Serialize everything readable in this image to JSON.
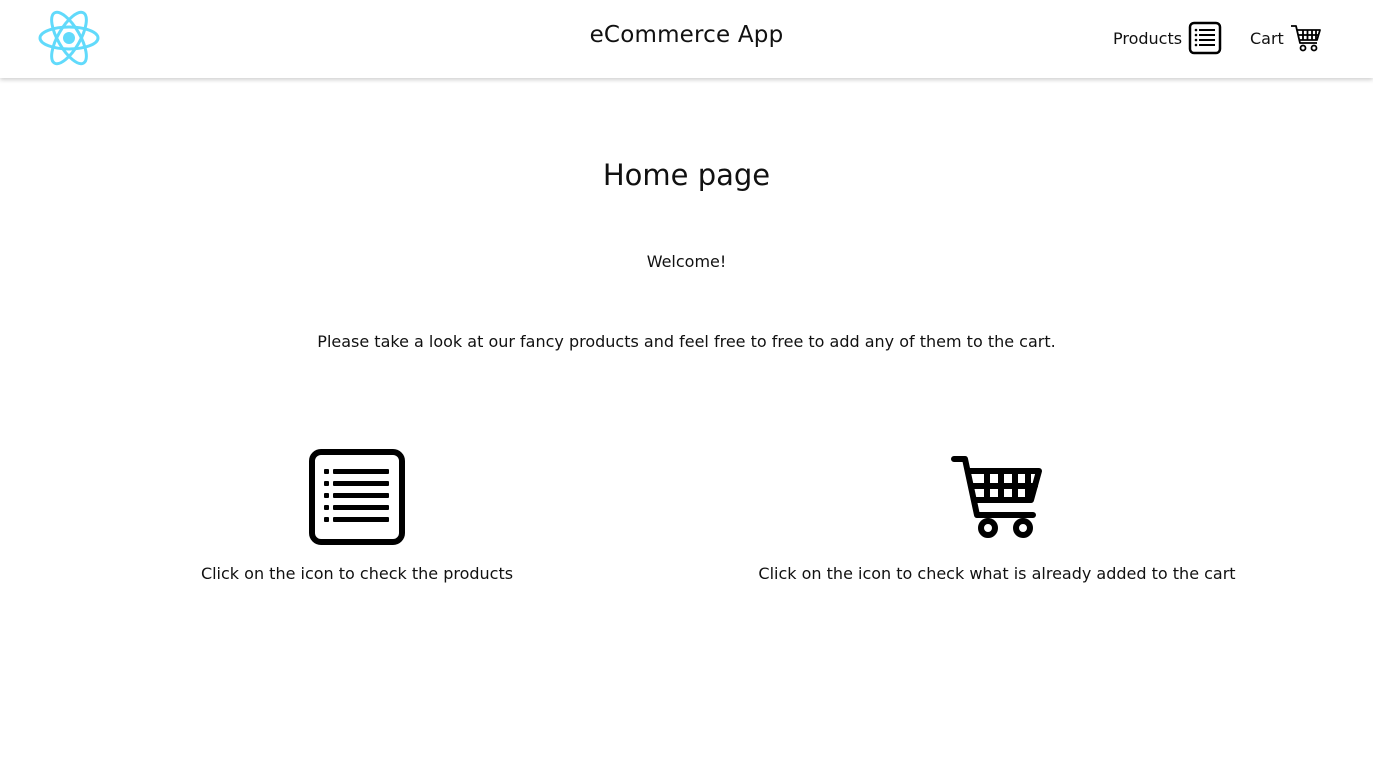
{
  "header": {
    "logo": "react-atom-icon",
    "title": "eCommerce App",
    "nav": {
      "products_label": "Products",
      "cart_label": "Cart"
    }
  },
  "main": {
    "title": "Home page",
    "welcome": "Welcome!",
    "intro": "Please take a look at our fancy products and feel free to free to add any of them to the cart.",
    "cards": [
      {
        "icon": "list-icon",
        "text": "Click on the icon to check the products"
      },
      {
        "icon": "shopping-cart-icon",
        "text": "Click on the icon to check what is already added to the cart"
      }
    ]
  },
  "colors": {
    "logo": "#61dafb",
    "text": "#111111",
    "background": "#ffffff"
  }
}
